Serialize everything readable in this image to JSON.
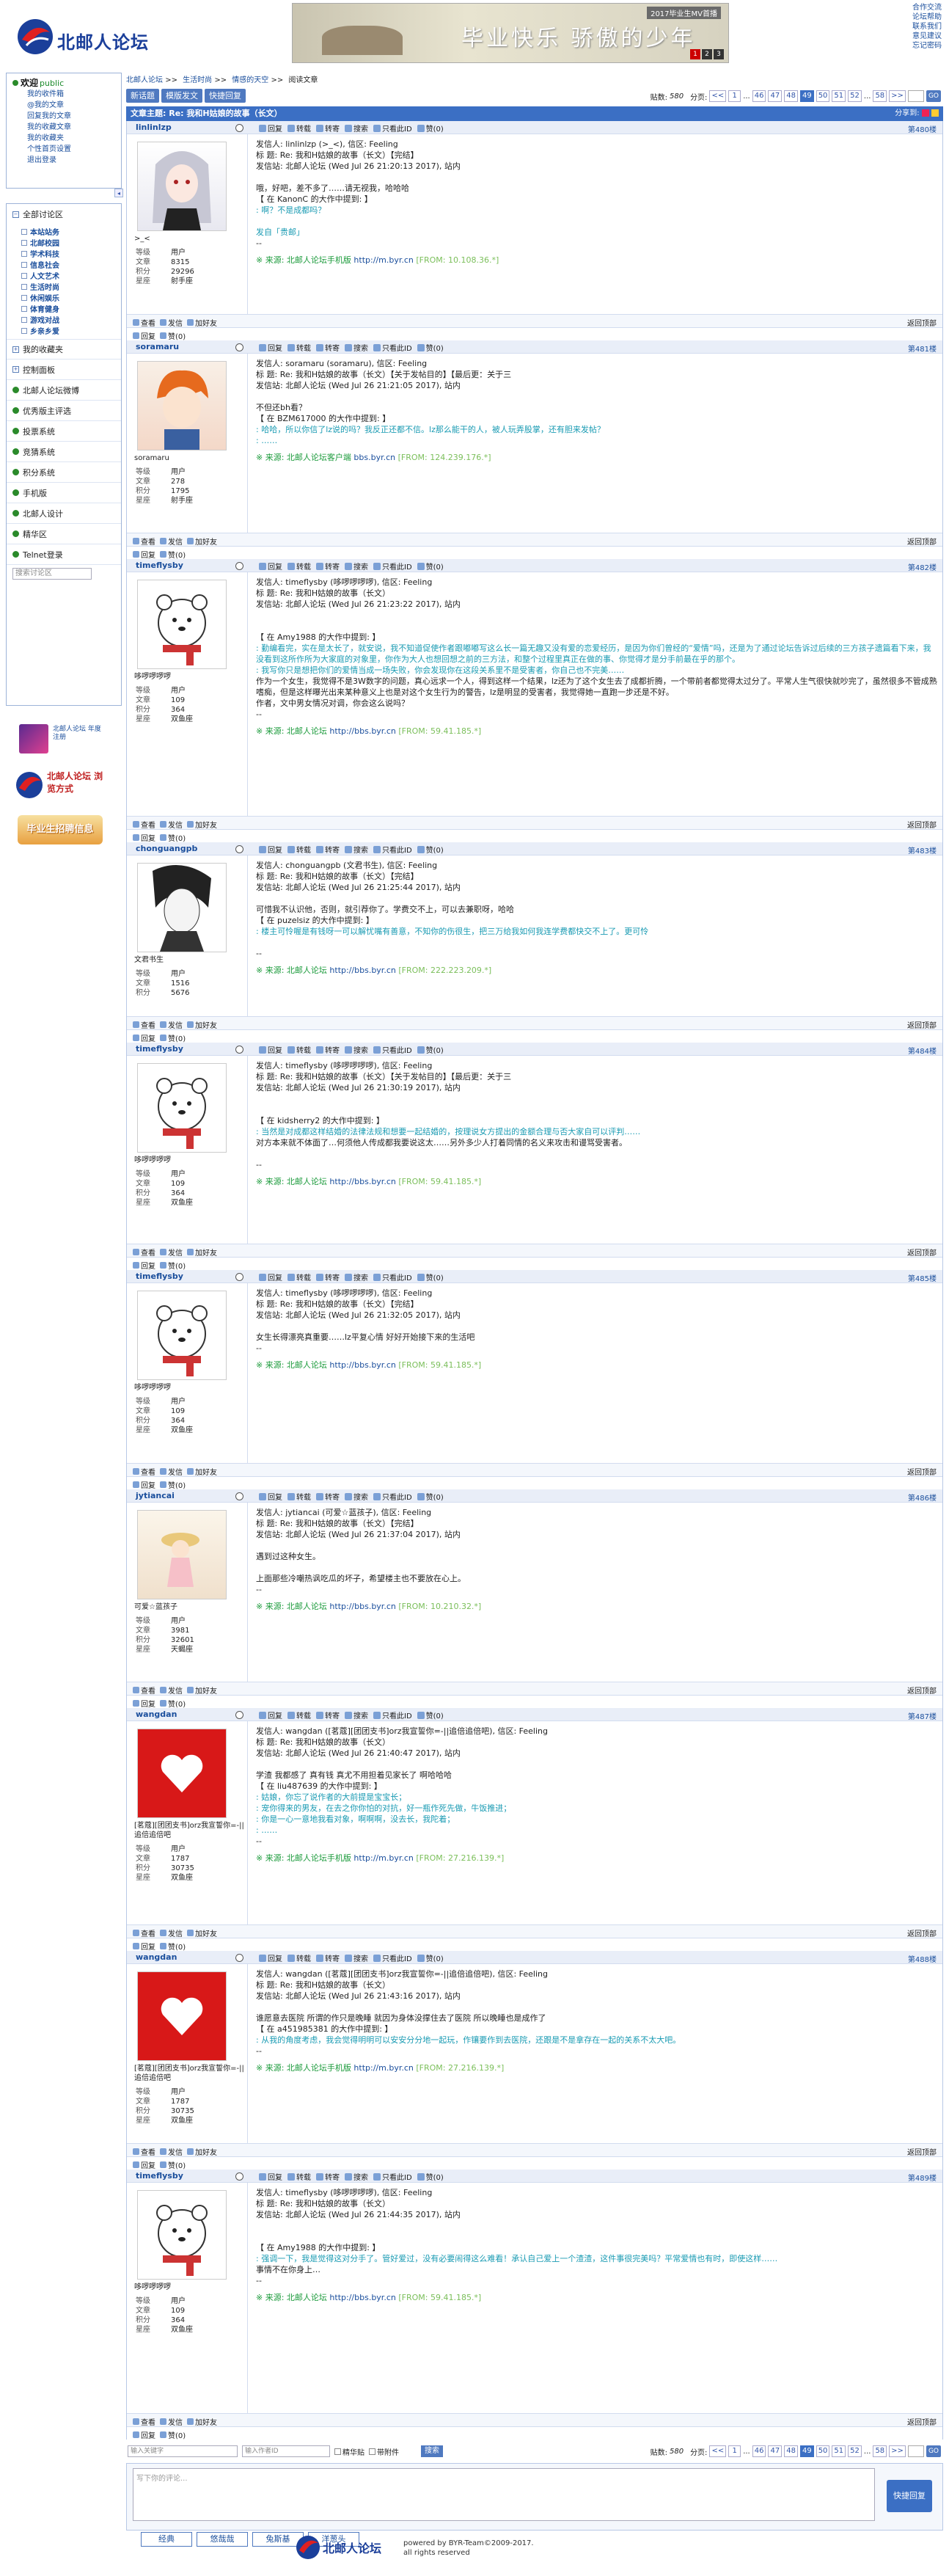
{
  "header": {
    "logo_text": "北邮人论坛",
    "banner_tag": "2017毕业生MV首播",
    "banner_title": "毕业快乐 骄傲的少年",
    "banner_pages": [
      "1",
      "2",
      "3"
    ],
    "links": [
      "合作交流",
      "论坛帮助",
      "联系我们",
      "意见建议",
      "忘记密码"
    ]
  },
  "sidebar": {
    "welcome": "欢迎",
    "welcome_user": "public",
    "welcome_links": [
      "我的收件箱",
      "@我的文章",
      "回复我的文章",
      "我的收藏文章",
      "我的收藏夹",
      "个性首页设置",
      "退出登录"
    ],
    "nav": [
      {
        "label": "全部讨论区"
      },
      {
        "label": "我的收藏夹"
      },
      {
        "label": "控制面板"
      },
      {
        "label": "北邮人论坛微博"
      },
      {
        "label": "优秀版主评选"
      },
      {
        "label": "投票系统"
      },
      {
        "label": "竞猜系统"
      },
      {
        "label": "积分系统"
      },
      {
        "label": "手机版"
      },
      {
        "label": "北邮人设计"
      },
      {
        "label": "精华区"
      },
      {
        "label": "Telnet登录"
      }
    ],
    "sections": [
      "本站站务",
      "北邮校园",
      "学术科技",
      "信息社会",
      "人文艺术",
      "生活时尚",
      "休闲娱乐",
      "体育健身",
      "游戏对战",
      "乡亲乡爱"
    ],
    "search_placeholder": "搜索讨论区",
    "ad1": "北邮人论坛 年度注册",
    "ad2": "北邮人论坛 浏览方式",
    "ad3": "毕业生招聘信息"
  },
  "breadcrumb": [
    "北邮人论坛",
    ">>",
    "生活时尚",
    ">>",
    "情感的天空",
    ">>",
    "阅读文章"
  ],
  "toolbar": {
    "new_post": "新话题",
    "mod_post": "模版发文",
    "quick_reply": "快捷回复",
    "post_count_label": "贴数:",
    "post_count": "580",
    "pages_label": "分页:",
    "pages": [
      "<<",
      "1",
      "...",
      "46",
      "47",
      "48",
      "49",
      "50",
      "51",
      "52",
      "...",
      "58",
      ">>"
    ],
    "current_page": "49",
    "go": "GO"
  },
  "thread": {
    "title": "文章主题: Re: 我和H姑娘的故事（长文）",
    "share": "分享到:"
  },
  "post_actions": [
    "回复",
    "转载",
    "转寄",
    "搜索",
    "只看此ID",
    "赞(0)"
  ],
  "footer_actions": [
    "查看",
    "发信",
    "加好友"
  ],
  "post_footer_like": [
    "回复",
    "赞(0)"
  ],
  "back_top": "返回顶部",
  "stat_labels": {
    "level": "等级",
    "posts": "文章",
    "score": "积分",
    "star": "星座"
  },
  "posts": [
    {
      "user": "linlinlzp",
      "floor": "第480楼",
      "nick": ">_<",
      "level": "用户",
      "posts": "8315",
      "score": "29296",
      "star": "射手座",
      "lines": [
        "发信人: linlinlzp (>_<), 信区: Feeling",
        "标  题: Re: 我和H姑娘的故事（长文）【完结】",
        "发信站: 北邮人论坛 (Wed Jul 26 21:20:13 2017), 站内",
        "",
        "哦，好吧，差不多了……请无视我，哈哈哈",
        "【 在 KanonC 的大作中提到: 】"
      ],
      "quote": [
        ": 啊？不是成都吗？",
        "",
        "发自「贵邮」"
      ],
      "tail": [
        "--"
      ],
      "src": "※ 来源: 北邮人论坛手机版 ",
      "src_link": "http://m.byr.cn",
      "ip": " [FROM: 10.108.36.*]"
    },
    {
      "user": "soramaru",
      "floor": "第481楼",
      "nick": "soramaru",
      "level": "用户",
      "posts": "278",
      "score": "1795",
      "star": "射手座",
      "lines": [
        "发信人: soramaru (soramaru), 信区: Feeling",
        "标  题: Re: 我和H姑娘的故事（长文）【关于发帖目的】【最后更：关于三",
        "发信站: 北邮人论坛 (Wed Jul 26 21:21:05 2017), 站内",
        "",
        "不但还bh看？",
        "【 在 BZM617000 的大作中提到: 】"
      ],
      "quote": [
        ": 哈哈，所以你信了lz说的吗？我反正还都不信。lz那么能干的人，被人玩弄股掌，还有胆来发帖？",
        ": ……"
      ],
      "tail": [],
      "src": "※ 来源: 北邮人论坛客户端 ",
      "src_link": "bbs.byr.cn",
      "ip": " [FROM: 124.239.176.*]"
    },
    {
      "user": "timeflysby",
      "floor": "第482楼",
      "nick": "哆啰啰啰啰",
      "level": "用户",
      "posts": "109",
      "score": "364",
      "star": "双鱼座",
      "lines": [
        "发信人: timeflysby (哆啰啰啰啰), 信区: Feeling",
        "标  题: Re: 我和H姑娘的故事（长文）",
        "发信站: 北邮人论坛 (Wed Jul 26 21:23:22 2017), 站内",
        "",
        "",
        "【 在 Amy1988 的大作中提到: 】"
      ],
      "quote": [
        ": 勤编看完，实在是太长了，就安说，我不知道促使作者跟嘟嘟写这么长一篇无趣又没有爱的恋爱经历，是因为你们曾经的“爱情”吗，还是为了通过论坛告诉过后续的三方孩子遗篇看下来，我没看到这所作所为大家庭的对象里，你作为大人也想回想之前的三方法，和整个过程里真正在做的事、你觉得才是分手前最在乎的那个。",
        ": 我写你只是想把你们的爱情当成一场失败，你会发现你在这段关系里不是受害者，你自己也不完美……"
      ],
      "tail": [
        "作为一个女生，我觉得不是3W数字的问题，真心远求一个人，得到这样一个结果，lz还为了这个女生去了成都折腾，一个带前者都觉得太过分了。平常人生气很快就吵完了，虽然很多不管成熟嗜痴，但是这样曝光出来某种意义上也是对这个女生行为的警告，lz是明显的受害者，我觉得她一直跑一步还是不好。",
        " 作者，文中男女情况对调，你会这么说吗？",
        "--"
      ],
      "src": "※ 来源: 北邮人论坛 ",
      "src_link": "http://bbs.byr.cn",
      "ip": " [FROM: 59.41.185.*]"
    },
    {
      "user": "chonguangpb",
      "floor": "第483楼",
      "nick": "文君书生",
      "level": "用户",
      "posts": "1516",
      "score": "5676",
      "star": "",
      "lines": [
        "发信人: chonguangpb (文君书生), 信区: Feeling",
        "标  题: Re: 我和H姑娘的故事（长文）【完结】",
        "发信站: 北邮人论坛 (Wed Jul 26 21:25:44 2017), 站内",
        "",
        "可惜我不认识他，否则，就引荐你了。学费交不上，可以去兼职呀，哈哈",
        "【 在 puzelsiz 的大作中提到: 】"
      ],
      "quote": [
        ": 楼主可怜喔是有钱呀一可以解忧嘴有善意，不知你的伤很生，把三万给我如何我连学费都快交不上了。更可怜"
      ],
      "tail": [
        "",
        "--"
      ],
      "src": "※ 来源: 北邮人论坛 ",
      "src_link": "http://bbs.byr.cn",
      "ip": " [FROM: 222.223.209.*]"
    },
    {
      "user": "timeflysby",
      "floor": "第484楼",
      "nick": "哆啰啰啰啰",
      "level": "用户",
      "posts": "109",
      "score": "364",
      "star": "双鱼座",
      "lines": [
        "发信人: timeflysby (哆啰啰啰啰), 信区: Feeling",
        "标  题: Re: 我和H姑娘的故事（长文）【关于发帖目的】【最后更：关于三",
        "发信站: 北邮人论坛 (Wed Jul 26 21:30:19 2017), 站内",
        "",
        "",
        "【 在 kidsherry2 的大作中提到: 】"
      ],
      "quote": [
        ": 当然是对成都这样结婚的法律法规和想要一起结婚的，按理说女方提出的金额合理与否大家自可以评判……"
      ],
      "tail": [
        "对方本来就不体面了…何须他人传成都我要说这太……另外多少人打着同情的名义来攻击和谩骂受害者。",
        "",
        "--"
      ],
      "src": "※ 来源: 北邮人论坛 ",
      "src_link": "http://bbs.byr.cn",
      "ip": " [FROM: 59.41.185.*]"
    },
    {
      "user": "timeflysby",
      "floor": "第485楼",
      "nick": "哆啰啰啰啰",
      "level": "用户",
      "posts": "109",
      "score": "364",
      "star": "双鱼座",
      "lines": [
        "发信人: timeflysby (哆啰啰啰啰), 信区: Feeling",
        "标  题: Re: 我和H姑娘的故事（长文）【完结】",
        "发信站: 北邮人论坛 (Wed Jul 26 21:32:05 2017), 站内",
        "",
        "女生长得漂亮真重要……lz平复心情 好好开始接下来的生活吧",
        "--"
      ],
      "quote": [],
      "tail": [],
      "src": "※ 来源: 北邮人论坛 ",
      "src_link": "http://bbs.byr.cn",
      "ip": " [FROM: 59.41.185.*]"
    },
    {
      "user": "jytiancai",
      "floor": "第486楼",
      "nick": "可爱☆蓝孩子",
      "level": "用户",
      "posts": "3981",
      "score": "32601",
      "star": "天蝎座",
      "lines": [
        "发信人: jytiancai (可爱☆蓝孩子), 信区: Feeling",
        "标  题: Re: 我和H姑娘的故事（长文）【完结】",
        "发信站: 北邮人论坛 (Wed Jul 26 21:37:04 2017), 站内",
        "",
        "遇到过这种女生。",
        "",
        "上面那些冷嘲热讽吃瓜的坏子，希望楼主也不要放在心上。",
        "--"
      ],
      "quote": [],
      "tail": [],
      "src": "※ 来源: 北邮人论坛 ",
      "src_link": "http://bbs.byr.cn",
      "ip": " [FROM: 10.210.32.*]"
    },
    {
      "user": "wangdan",
      "floor": "第487楼",
      "nick": "[茗蔻][团团支书]orz我宣誓你=-||追倍追倍吧",
      "level": "用户",
      "posts": "1787",
      "score": "30735",
      "star": "双鱼座",
      "lines": [
        "发信人: wangdan ([茗蔻][团团支书]orz我宣誓你=-||追倍追倍吧), 信区: Feeling",
        "标  题: Re: 我和H姑娘的故事（长文）",
        "发信站: 北邮人论坛 (Wed Jul 26 21:40:47 2017), 站内",
        "",
        "学渣 我都感了 真有钱 真尤不用担着见家长了 啊哈哈哈",
        "【 在 liu487639 的大作中提到: 】"
      ],
      "quote": [
        ": 姑娘，你忘了说作者的大前提是宝宝长；",
        ": 宠你得来的男友，在去之你你怕的对抗，好一瓶作死先做，牛饭推进；",
        ": 你是一心一意地我看对象，啊啊啊，没去长，我陀着；",
        ": ……"
      ],
      "tail": [
        "--"
      ],
      "src": "※ 来源: 北邮人论坛手机版 ",
      "src_link": "http://m.byr.cn",
      "ip": " [FROM: 27.216.139.*]"
    },
    {
      "user": "wangdan",
      "floor": "第488楼",
      "nick": "[茗蔻][团团支书]orz我宣誓你=-||追倍追倍吧",
      "level": "用户",
      "posts": "1787",
      "score": "30735",
      "star": "双鱼座",
      "lines": [
        "发信人: wangdan ([茗蔻][团团支书]orz我宣誓你=-||追倍追倍吧), 信区: Feeling",
        "标  题: Re: 我和H姑娘的故事（长文）",
        "发信站: 北邮人论坛 (Wed Jul 26 21:43:16 2017), 站内",
        "",
        "谁愿意去医院 所谓的作只是晚睡 就因为身体没撑住去了医院 所以晚睡也是成作了",
        "【 在 a451985381 的大作中提到: 】"
      ],
      "quote": [
        ": 从我的角度考虑，我会觉得明明可以安安分分地一起玩，作镶要作到去医院，还跟是不是拿存在一起的关系不太大吧。"
      ],
      "tail": [
        "--"
      ],
      "src": "※ 来源: 北邮人论坛手机版 ",
      "src_link": "http://m.byr.cn",
      "ip": " [FROM: 27.216.139.*]"
    },
    {
      "user": "timeflysby",
      "floor": "第489楼",
      "nick": "哆啰啰啰啰",
      "level": "用户",
      "posts": "109",
      "score": "364",
      "star": "双鱼座",
      "lines": [
        "发信人: timeflysby (哆啰啰啰啰), 信区: Feeling",
        "标  题: Re: 我和H姑娘的故事（长文）",
        "发信站: 北邮人论坛 (Wed Jul 26 21:44:35 2017), 站内",
        "",
        "",
        "【 在 Amy1988 的大作中提到: 】"
      ],
      "quote": [
        ": 强调一下，我是觉得这对分手了。管好爱过，没有必要闹得这么难看！承认自己爱上一个渣渣，这件事很完美吗？平常爱情也有时，即使这样……"
      ],
      "tail": [
        "事情不在你身上…",
        "--"
      ],
      "src": "※ 来源: 北邮人论坛 ",
      "src_link": "http://bbs.byr.cn",
      "ip": " [FROM: 59.41.185.*]"
    }
  ],
  "bottom": {
    "search_placeholder": "输入关键字",
    "author_placeholder": "输入作者ID",
    "opt1": "精华贴",
    "opt2": "带附件",
    "search_btn": "搜索"
  },
  "reply": {
    "placeholder": "写下你的评论...",
    "btn": "快捷回复"
  },
  "style_tabs": [
    "经典",
    "悠哉哉",
    "兔斯基",
    "洋葱头"
  ],
  "footer": {
    "logo_text": "北邮人论坛",
    "line1": "powered by BYR-Team©2009-2017.",
    "line2": "all rights reserved"
  }
}
